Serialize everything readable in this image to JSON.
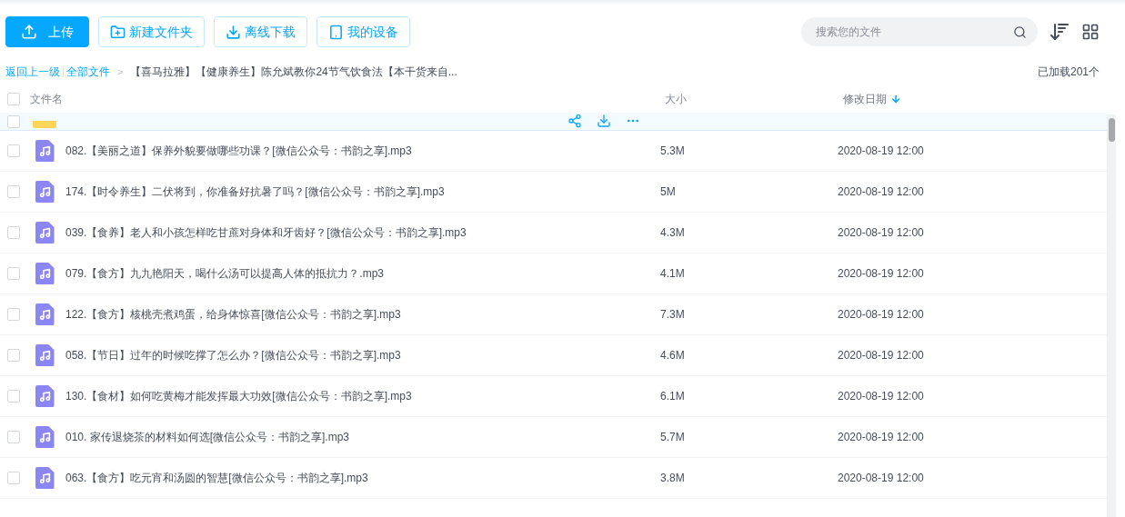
{
  "toolbar": {
    "buttons": [
      {
        "label": "上传",
        "kind": "primary"
      },
      {
        "label": "新建文件夹",
        "kind": "outline"
      },
      {
        "label": "离线下载",
        "kind": "outline"
      },
      {
        "label": "我的设备",
        "kind": "outline"
      }
    ],
    "search": {
      "placeholder": "搜索您的文件"
    }
  },
  "breadcrumb": {
    "back": "返回上一级",
    "root": "全部文件",
    "separator": ">",
    "current": "【喜马拉雅】【健康养生】陈允斌教你24节气饮食法【本干货来自...",
    "loaded": "已加载201个"
  },
  "table": {
    "select_all": {
      "checked": false
    },
    "columns": [
      {
        "label": "文件名",
        "sorted": false
      },
      {
        "label": "大小",
        "sorted": false
      },
      {
        "label": "修改日期",
        "sorted": true
      }
    ],
    "rows": [
      {
        "kind": "folder",
        "hovered": true,
        "checked": false
      },
      {
        "kind": "audio",
        "hovered": false,
        "checked": false,
        "name": "082.【美丽之道】保养外貌要做哪些功课？[微信公众号：书韵之享].mp3",
        "size": "5.3M",
        "date": "2020-08-19 12:00"
      },
      {
        "kind": "audio",
        "hovered": false,
        "checked": false,
        "name": "174.【时令养生】二伏将到，你准备好抗暑了吗？[微信公众号：书韵之享].mp3",
        "size": "5M",
        "date": "2020-08-19 12:00"
      },
      {
        "kind": "audio",
        "hovered": false,
        "checked": false,
        "name": "039.【食养】老人和小孩怎样吃甘蔗对身体和牙齿好？[微信公众号：书韵之享].mp3",
        "size": "4.3M",
        "date": "2020-08-19 12:00"
      },
      {
        "kind": "audio",
        "hovered": false,
        "checked": false,
        "name": "079.【食方】九九艳阳天，喝什么汤可以提高人体的抵抗力？.mp3",
        "size": "4.1M",
        "date": "2020-08-19 12:00"
      },
      {
        "kind": "audio",
        "hovered": false,
        "checked": false,
        "name": "122.【食方】核桃壳煮鸡蛋，给身体惊喜[微信公众号：书韵之享].mp3",
        "size": "7.3M",
        "date": "2020-08-19 12:00"
      },
      {
        "kind": "audio",
        "hovered": false,
        "checked": false,
        "name": "058.【节日】过年的时候吃撑了怎么办？[微信公众号：书韵之享].mp3",
        "size": "4.6M",
        "date": "2020-08-19 12:00"
      },
      {
        "kind": "audio",
        "hovered": false,
        "checked": false,
        "name": "130.【食材】如何吃黄梅才能发挥最大功效[微信公众号：书韵之享].mp3",
        "size": "6.1M",
        "date": "2020-08-19 12:00"
      },
      {
        "kind": "audio",
        "hovered": false,
        "checked": false,
        "name": "010. 家传退烧茶的材料如何选[微信公众号：书韵之享].mp3",
        "size": "5.7M",
        "date": "2020-08-19 12:00"
      },
      {
        "kind": "audio",
        "hovered": false,
        "checked": false,
        "name": "063.【食方】吃元宵和汤圆的智慧[微信公众号：书韵之享].mp3",
        "size": "3.8M",
        "date": "2020-08-19 12:00"
      }
    ]
  }
}
